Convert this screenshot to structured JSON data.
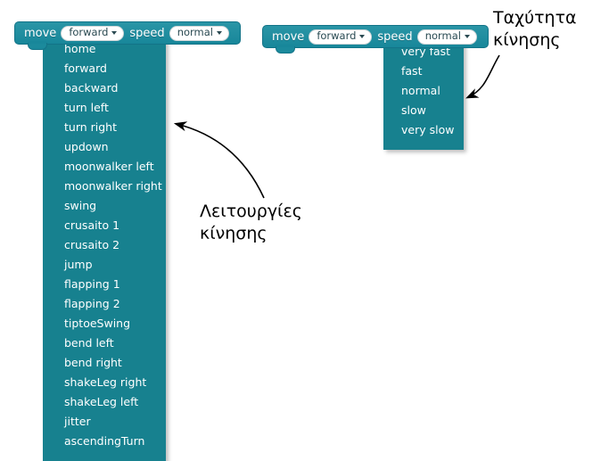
{
  "blocks": [
    {
      "name": "move-block-1",
      "move_label": "move",
      "direction_value": "forward",
      "speed_label": "speed",
      "speed_value": "normal"
    },
    {
      "name": "move-block-2",
      "move_label": "move",
      "direction_value": "forward",
      "speed_label": "speed",
      "speed_value": "normal"
    }
  ],
  "motions_menu": {
    "items": [
      "home",
      "forward",
      "backward",
      "turn left",
      "turn right",
      "updown",
      "moonwalker left",
      "moonwalker right",
      "swing",
      "crusaito 1",
      "crusaito 2",
      "jump",
      "flapping 1",
      "flapping 2",
      "tiptoeSwing",
      "bend left",
      "bend right",
      "shakeLeg right",
      "shakeLeg left",
      "jitter",
      "ascendingTurn"
    ]
  },
  "speed_menu": {
    "items": [
      "very fast",
      "fast",
      "normal",
      "slow",
      "very slow"
    ]
  },
  "annotations": {
    "speed": "Ταχύτητα\nκίνησης",
    "motions": "Λειτουργίες\nκίνησης"
  },
  "colors": {
    "block_teal": "#1b8a9c",
    "menu_teal": "#17818f",
    "pill_white": "#ffffff",
    "pill_text": "#2a4a52",
    "annotation_text": "#000000"
  }
}
